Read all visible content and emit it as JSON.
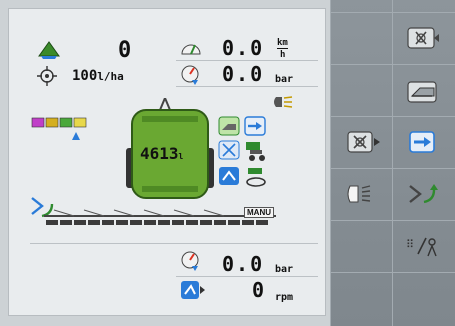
{
  "colors": {
    "tank_green": "#6aa832",
    "tank_dark": "#3f7a1e",
    "panel_bg": "#e9ecee",
    "softkey_bg": "#858d93",
    "accent_blue": "#2a7bd8"
  },
  "top_left": {
    "area_value": "0",
    "rate_value": "100",
    "rate_unit": "l/ha"
  },
  "speed": {
    "value": "0.0",
    "unit_top": "km",
    "unit_bottom": "h"
  },
  "pressure_top": {
    "value": "0.0",
    "unit": "bar"
  },
  "tank": {
    "value": "4613",
    "unit": "l"
  },
  "boom": {
    "mode_label": "MANU"
  },
  "bottom": {
    "pressure_value": "0.0",
    "pressure_unit": "bar",
    "rpm_value": "0",
    "rpm_unit": "rpm"
  },
  "softkeys": [
    {
      "name": "nozzle-toggle-icon"
    },
    {
      "name": "tractor-tank-icon"
    },
    {
      "name": "section-control-icon"
    },
    {
      "name": "enter-boom-icon"
    },
    {
      "name": "light-icon"
    },
    {
      "name": "arrow-ramp-icon"
    },
    {
      "name": "switch-user-icon"
    }
  ]
}
